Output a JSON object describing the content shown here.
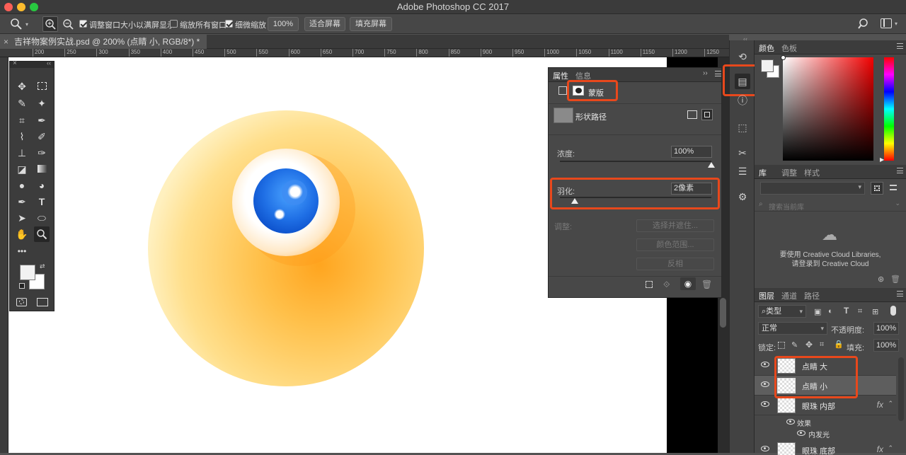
{
  "app": {
    "title": "Adobe Photoshop CC 2017"
  },
  "optionbar": {
    "resize_windows": "调整窗口大小以满屏显示",
    "zoom_all": "缩放所有窗口",
    "scrubby_zoom": "细微缩放",
    "zoom_value": "100%",
    "fit_screen": "适合屏幕",
    "fill_screen": "填充屏幕"
  },
  "document": {
    "tab_title": "吉祥物案例实战.psd @ 200% (点睛 小, RGB/8*) *"
  },
  "ruler": {
    "ticks": [
      "200",
      "250",
      "300",
      "350",
      "400",
      "450",
      "500",
      "550",
      "600",
      "650",
      "700",
      "750",
      "800",
      "850",
      "900",
      "950",
      "1000",
      "1050",
      "1100",
      "1150",
      "1200",
      "1250"
    ]
  },
  "properties": {
    "tab_properties": "属性",
    "tab_info": "信息",
    "mask_label": "蒙版",
    "shape_path": "形状路径",
    "density_label": "浓度:",
    "density_value": "100%",
    "density_level": 1.0,
    "feather_label": "羽化:",
    "feather_value": "2像素",
    "refine_label": "调整:",
    "select_mask": "选择并遮住...",
    "color_range": "颜色范围...",
    "invert": "反相"
  },
  "color_panel": {
    "tab_color": "颜色",
    "tab_swatches": "色板"
  },
  "library_panel": {
    "tab_library": "库",
    "tab_adjust": "调整",
    "tab_style": "样式",
    "search_placeholder": "搜索当前库",
    "message_line1": "要使用 Creative Cloud Libraries,",
    "message_line2": "请登录到 Creative Cloud"
  },
  "layers_panel": {
    "tab_layers": "图层",
    "tab_channels": "通道",
    "tab_paths": "路径",
    "filter_kind": "类型",
    "blend_mode": "正常",
    "opacity_label": "不透明度:",
    "opacity_value": "100%",
    "lock_label": "锁定:",
    "fill_label": "填充:",
    "fill_value": "100%",
    "layers": [
      {
        "name": "点睛 大",
        "fx": ""
      },
      {
        "name": "点睛 小",
        "fx": ""
      },
      {
        "name": "眼珠 内部",
        "fx": "fx"
      },
      {
        "name": "眼珠 底部",
        "fx": "fx"
      }
    ],
    "effects_label": "效果",
    "inner_glow": "内发光"
  },
  "colors": {
    "accent_highlight": "#e8481c",
    "foreground": "#f2f2f2",
    "background": "#ffffff"
  }
}
